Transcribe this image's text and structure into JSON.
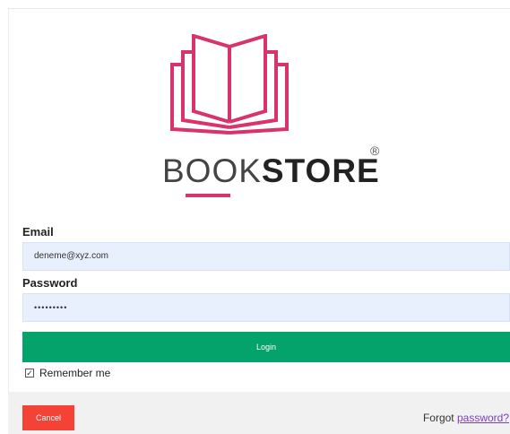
{
  "brand": {
    "wordmark_light": "BOOK",
    "wordmark_bold": "STORE",
    "registered_mark": "®",
    "logo_icon": "open-book-icon",
    "accent_color": "#d8336b"
  },
  "form": {
    "email_label": "Email",
    "email_value": "deneme@xyz.com",
    "password_label": "Password",
    "password_value": "•••••••••",
    "login_label": "Login",
    "remember_label": "Remember me",
    "remember_checked": true,
    "login_color": "#04a36b"
  },
  "footer": {
    "cancel_label": "Cancel",
    "forgot_prefix": "Forgot",
    "forgot_link": "password?",
    "cancel_color": "#f44336"
  }
}
